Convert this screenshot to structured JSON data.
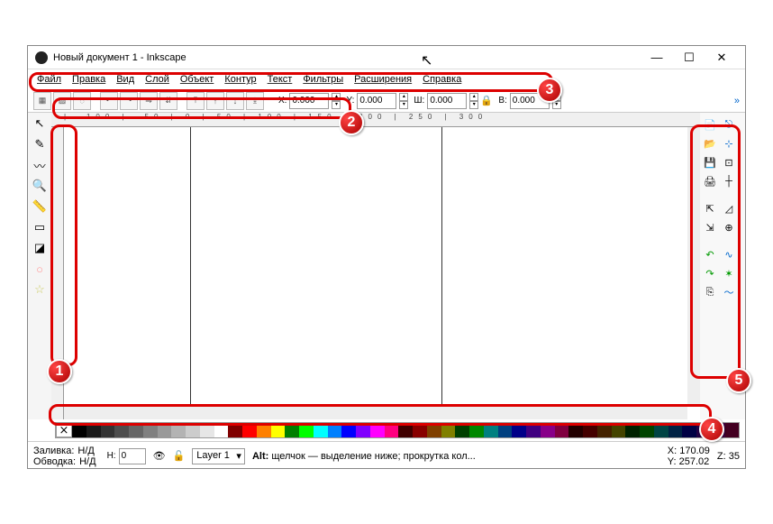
{
  "window": {
    "title": "Новый документ 1 - Inkscape"
  },
  "menu": {
    "items": [
      "Файл",
      "Правка",
      "Вид",
      "Слой",
      "Объект",
      "Контур",
      "Текст",
      "Фильтры",
      "Расширения",
      "Справка"
    ]
  },
  "coords": {
    "x_label": "X:",
    "x": "0.000",
    "y_label": "Y:",
    "y": "0.000",
    "w_label": "Ш:",
    "w": "0.000",
    "h_label": "В:",
    "h": "0.000"
  },
  "ruler": "|  -100   |   -50   |    0    |    50   |   100   |   150   |   200   |   250   |   300",
  "status": {
    "fill_label": "Заливка:",
    "fill_val": "Н/Д",
    "stroke_label": "Обводка:",
    "stroke_val": "Н/Д",
    "h_label": "Н:",
    "h_val": "0",
    "layer": "Layer 1",
    "hint_prefix": "Alt:",
    "hint": "щелчок — выделение ниже; прокрутка кол...",
    "cx_label": "X:",
    "cx": "170.09",
    "cy_label": "Y:",
    "cy": "257.02",
    "z_label": "Z:",
    "z": "35"
  },
  "palette": [
    "#000",
    "#1a1a1a",
    "#333",
    "#4d4d4d",
    "#666",
    "#808080",
    "#999",
    "#b3b3b3",
    "#ccc",
    "#e6e6e6",
    "#fff",
    "#800000",
    "#f00",
    "#ff8000",
    "#ff0",
    "#008000",
    "#0f0",
    "#00ffff",
    "#0080ff",
    "#00f",
    "#8000ff",
    "#f0f",
    "#ff0080",
    "#400000",
    "#800",
    "#804000",
    "#808000",
    "#004000",
    "#080",
    "#008080",
    "#004080",
    "#008",
    "#400080",
    "#808",
    "#800040",
    "#200",
    "#400",
    "#420",
    "#440",
    "#020",
    "#040",
    "#044",
    "#024",
    "#004",
    "#204",
    "#404",
    "#402"
  ],
  "annotations": [
    "1",
    "2",
    "3",
    "4",
    "5"
  ]
}
